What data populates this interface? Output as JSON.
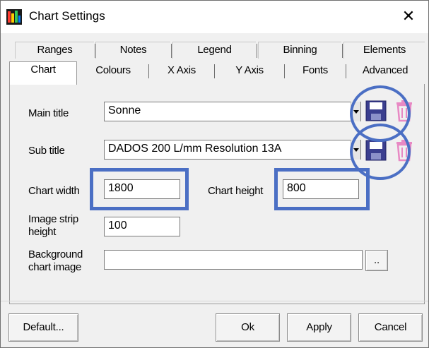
{
  "window": {
    "title": "Chart Settings",
    "close_glyph": "✕",
    "app_icon": "chart-settings-app-icon"
  },
  "tabs": {
    "row1": [
      "Ranges",
      "Notes",
      "Legend",
      "Binning",
      "Elements"
    ],
    "row2": [
      "Chart",
      "Colours",
      "X Axis",
      "Y Axis",
      "Fonts",
      "Advanced"
    ],
    "active": "Chart"
  },
  "form": {
    "main_title_label": "Main title",
    "main_title_value": "Sonne",
    "sub_title_label": "Sub title",
    "sub_title_value": "DADOS 200 L/mm Resolution 13A",
    "chart_width_label": "Chart width",
    "chart_width_value": "1800",
    "chart_height_label": "Chart height",
    "chart_height_value": "800",
    "image_strip_label": "Image strip height",
    "image_strip_value": "100",
    "background_label": "Background chart image",
    "background_value": "",
    "browse_label": ".."
  },
  "buttons": {
    "default": "Default...",
    "ok": "Ok",
    "apply": "Apply",
    "cancel": "Cancel"
  },
  "colors": {
    "highlight": "#4b6fc4",
    "save_icon": "#3b3f8f",
    "delete_icon": "#e889c4"
  },
  "icons": [
    "save-disk-icon",
    "trash-icon"
  ]
}
